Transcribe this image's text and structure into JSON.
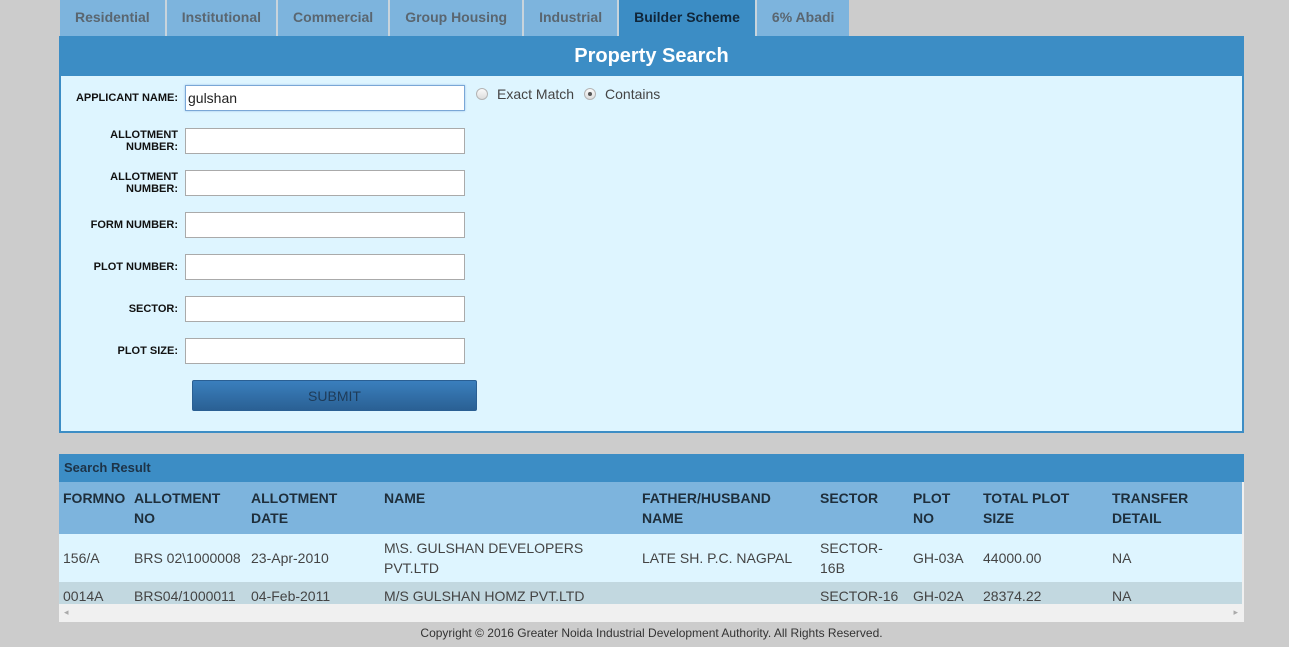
{
  "tabs": [
    {
      "label": "Residential",
      "active": false
    },
    {
      "label": "Institutional",
      "active": false
    },
    {
      "label": "Commercial",
      "active": false
    },
    {
      "label": "Group Housing",
      "active": false
    },
    {
      "label": "Industrial",
      "active": false
    },
    {
      "label": "Builder Scheme",
      "active": true
    },
    {
      "label": "6% Abadi",
      "active": false
    }
  ],
  "form": {
    "title": "Property Search",
    "fields": [
      {
        "label": "APPLICANT NAME:",
        "value": "gulshan"
      },
      {
        "label": "ALLOTMENT NUMBER:",
        "value": ""
      },
      {
        "label": "ALLOTMENT NUMBER:",
        "value": ""
      },
      {
        "label": "FORM NUMBER:",
        "value": ""
      },
      {
        "label": "PLOT NUMBER:",
        "value": ""
      },
      {
        "label": "SECTOR:",
        "value": ""
      },
      {
        "label": "PLOT SIZE:",
        "value": ""
      }
    ],
    "match_options": [
      {
        "label": "Exact Match",
        "checked": false
      },
      {
        "label": "Contains",
        "checked": true
      }
    ],
    "submit_label": "SUBMIT"
  },
  "results": {
    "title": "Search Result",
    "columns": [
      "FORMNO",
      "ALLOTMENT NO",
      "ALLOTMENT DATE",
      "NAME",
      "FATHER/HUSBAND NAME",
      "SECTOR",
      "PLOT NO",
      "TOTAL PLOT SIZE",
      "TRANSFER DETAIL"
    ],
    "rows": [
      [
        "156/A",
        "BRS 02\\1000008",
        "23-Apr-2010",
        "M\\S. GULSHAN DEVELOPERS PVT.LTD",
        "LATE SH. P.C. NAGPAL",
        "SECTOR-16B",
        "GH-03A",
        "44000.00",
        "NA"
      ],
      [
        "0014A",
        "BRS04/1000011",
        "04-Feb-2011",
        "M/S GULSHAN HOMZ PVT.LTD",
        "",
        "SECTOR-16",
        "GH-02A",
        "28374.22",
        "NA"
      ]
    ]
  },
  "footer": {
    "copyright": "Copyright © 2016 Greater Noida Industrial Development Authority. All Rights Reserved."
  },
  "icons": {
    "scroll_left": "◂",
    "scroll_right": "▸"
  }
}
